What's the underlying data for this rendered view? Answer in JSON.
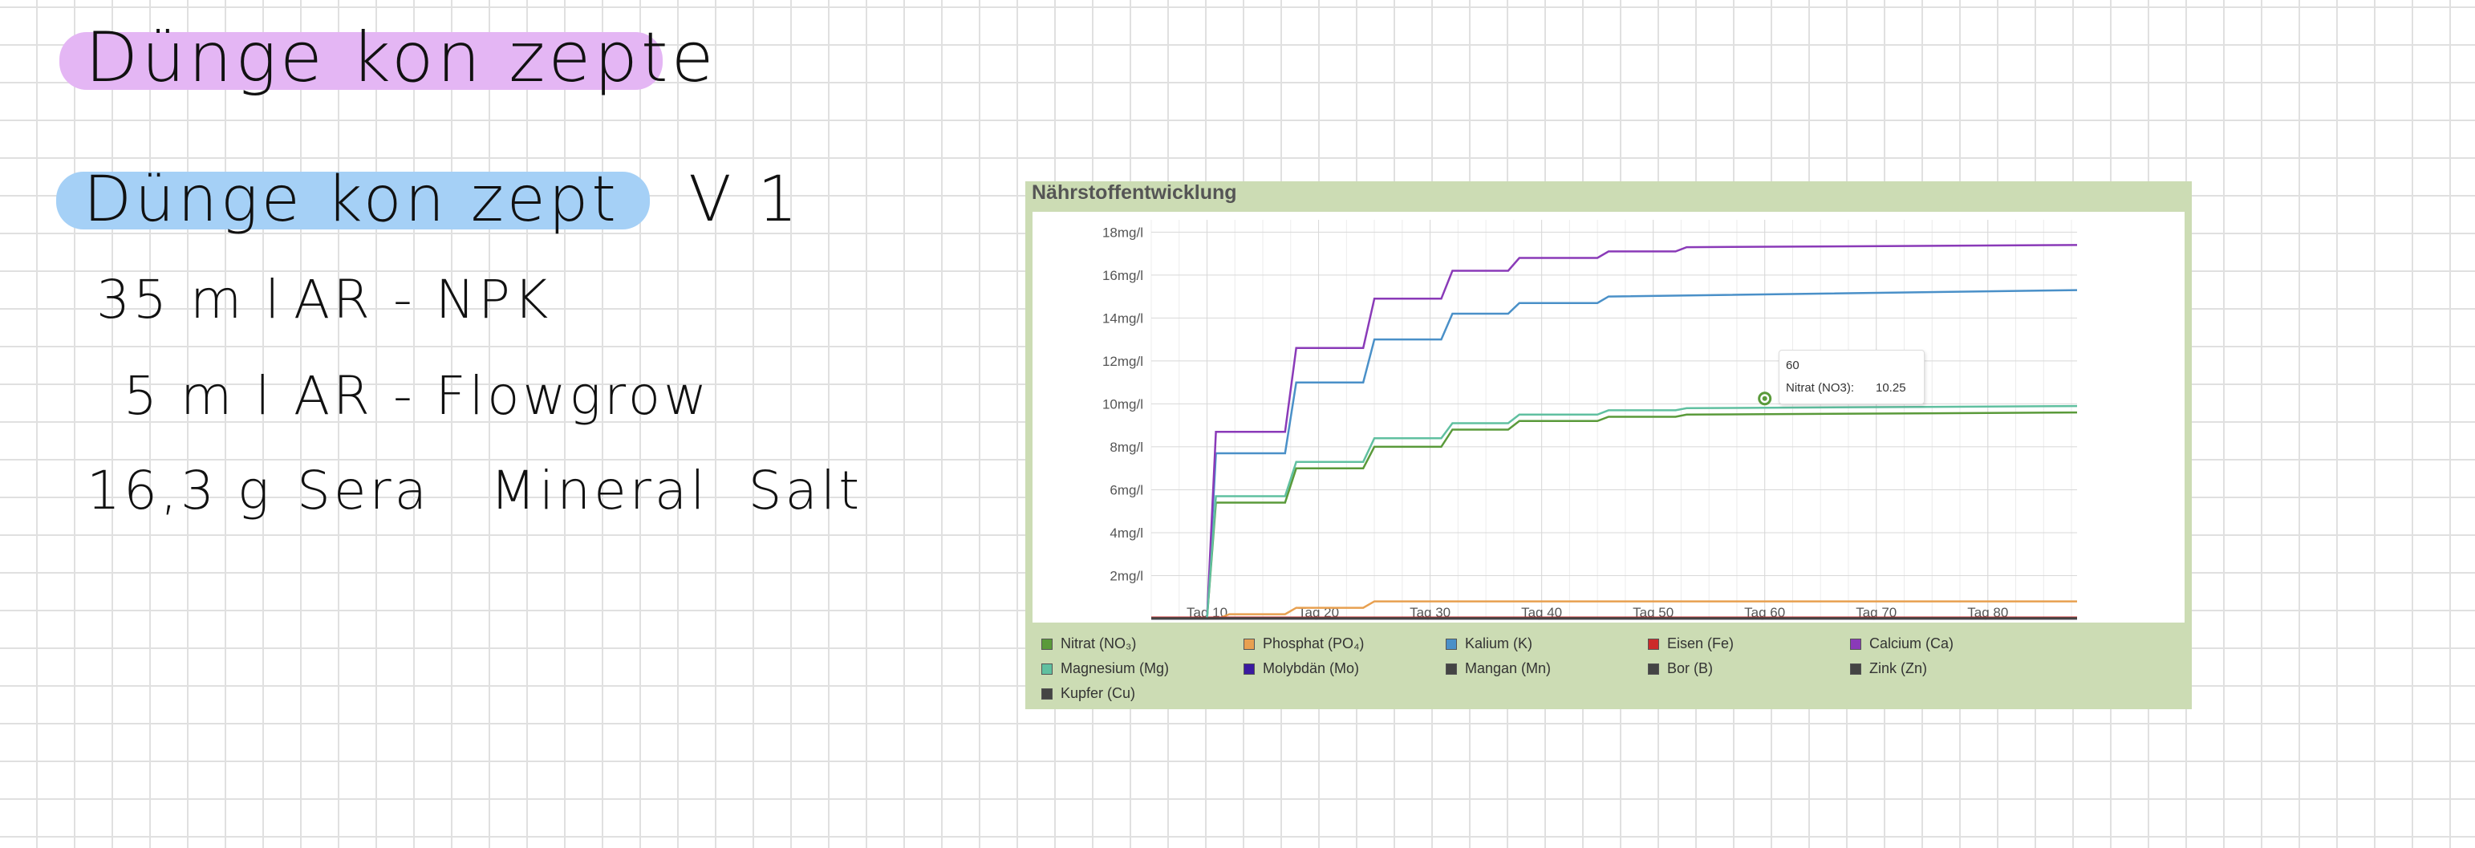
{
  "notes": {
    "title": "Dünge kon zepte",
    "subtitle": "Dünge kon zept   V 1",
    "doses": [
      {
        "amount": "35 m l",
        "product": "AR - NPK"
      },
      {
        "amount": "5 m l",
        "product": "AR - Flowgrow"
      },
      {
        "amount": "16,3 g",
        "product": "Sera   Mineral  Salt"
      }
    ],
    "colors": {
      "title_highlight": "#e4b6f4",
      "subtitle_highlight": "#a5d0f6",
      "grid": "#e0e0e0"
    }
  },
  "chart_panel": {
    "title": "Nährstoffentwicklung",
    "background": "#ccdcb4",
    "tooltip": {
      "x_label": "60",
      "series_name": "Nitrat (NO3):",
      "value": "10.25"
    }
  },
  "chart_data": {
    "type": "line",
    "title": "Nährstoffentwicklung",
    "xlabel": "",
    "ylabel": "",
    "x_ticks": [
      "Tag 10",
      "Tag 20",
      "Tag 30",
      "Tag 40",
      "Tag 50",
      "Tag 60",
      "Tag 70",
      "Tag 80"
    ],
    "x_tick_values": [
      10,
      20,
      30,
      40,
      50,
      60,
      70,
      80
    ],
    "y_ticks": [
      "2mg/l",
      "4mg/l",
      "6mg/l",
      "8mg/l",
      "10mg/l",
      "12mg/l",
      "14mg/l",
      "16mg/l",
      "18mg/l"
    ],
    "y_tick_values": [
      2,
      4,
      6,
      8,
      10,
      12,
      14,
      16,
      18
    ],
    "xlim": [
      5,
      88
    ],
    "ylim": [
      0,
      18.2
    ],
    "grid": true,
    "legend_position": "bottom",
    "series": [
      {
        "name": "Nitrat (NO₃)",
        "color": "#5a9a3a",
        "points": [
          [
            5,
            0
          ],
          [
            10,
            0
          ],
          [
            10.8,
            5.4
          ],
          [
            17,
            5.4
          ],
          [
            18,
            7.0
          ],
          [
            24,
            7.0
          ],
          [
            25,
            8.0
          ],
          [
            31,
            8.0
          ],
          [
            32,
            8.8
          ],
          [
            37,
            8.8
          ],
          [
            38,
            9.2
          ],
          [
            45,
            9.2
          ],
          [
            46,
            9.4
          ],
          [
            52,
            9.4
          ],
          [
            53,
            9.5
          ],
          [
            88,
            9.6
          ]
        ]
      },
      {
        "name": "Phosphat (PO₄)",
        "color": "#e8a050",
        "points": [
          [
            5,
            0
          ],
          [
            11,
            0
          ],
          [
            12,
            0.2
          ],
          [
            17,
            0.2
          ],
          [
            18,
            0.5
          ],
          [
            24,
            0.5
          ],
          [
            25,
            0.8
          ],
          [
            88,
            0.8
          ]
        ]
      },
      {
        "name": "Kalium (K)",
        "color": "#4a90c8",
        "points": [
          [
            5,
            0
          ],
          [
            10,
            0
          ],
          [
            10.8,
            7.7
          ],
          [
            17,
            7.7
          ],
          [
            18,
            11.0
          ],
          [
            24,
            11.0
          ],
          [
            25,
            13.0
          ],
          [
            31,
            13.0
          ],
          [
            32,
            14.2
          ],
          [
            37,
            14.2
          ],
          [
            38,
            14.7
          ],
          [
            45,
            14.7
          ],
          [
            46,
            15.0
          ],
          [
            88,
            15.3
          ]
        ]
      },
      {
        "name": "Eisen (Fe)",
        "color": "#cc2a2a",
        "points": [
          [
            5,
            0.05
          ],
          [
            88,
            0.05
          ]
        ]
      },
      {
        "name": "Calcium (Ca)",
        "color": "#8a3ab8",
        "points": [
          [
            5,
            0
          ],
          [
            10,
            0
          ],
          [
            10.8,
            8.7
          ],
          [
            17,
            8.7
          ],
          [
            18,
            12.6
          ],
          [
            24,
            12.6
          ],
          [
            25,
            14.9
          ],
          [
            31,
            14.9
          ],
          [
            32,
            16.2
          ],
          [
            37,
            16.2
          ],
          [
            38,
            16.8
          ],
          [
            45,
            16.8
          ],
          [
            46,
            17.1
          ],
          [
            52,
            17.1
          ],
          [
            53,
            17.3
          ],
          [
            88,
            17.4
          ]
        ]
      },
      {
        "name": "Magnesium (Mg)",
        "color": "#60c0a0",
        "points": [
          [
            5,
            0
          ],
          [
            10,
            0
          ],
          [
            10.8,
            5.7
          ],
          [
            17,
            5.7
          ],
          [
            18,
            7.3
          ],
          [
            24,
            7.3
          ],
          [
            25,
            8.4
          ],
          [
            31,
            8.4
          ],
          [
            32,
            9.1
          ],
          [
            37,
            9.1
          ],
          [
            38,
            9.5
          ],
          [
            45,
            9.5
          ],
          [
            46,
            9.7
          ],
          [
            52,
            9.7
          ],
          [
            53,
            9.8
          ],
          [
            88,
            9.9
          ]
        ]
      },
      {
        "name": "Molybdän (Mo)",
        "color": "#3a1aa0",
        "points": [
          [
            5,
            0
          ],
          [
            88,
            0
          ]
        ]
      },
      {
        "name": "Mangan (Mn)",
        "color": "#444444",
        "points": [
          [
            5,
            0.02
          ],
          [
            88,
            0.02
          ]
        ]
      },
      {
        "name": "Bor (B)",
        "color": "#444444",
        "points": [
          [
            5,
            0.01
          ],
          [
            88,
            0.01
          ]
        ]
      },
      {
        "name": "Zink (Zn)",
        "color": "#444444",
        "points": [
          [
            5,
            0
          ],
          [
            88,
            0
          ]
        ]
      },
      {
        "name": "Kupfer (Cu)",
        "color": "#444444",
        "points": [
          [
            5,
            0
          ],
          [
            88,
            0
          ]
        ]
      }
    ],
    "highlight_point": {
      "series": "Nitrat (NO₃)",
      "x": 60,
      "y": 10.25
    }
  }
}
